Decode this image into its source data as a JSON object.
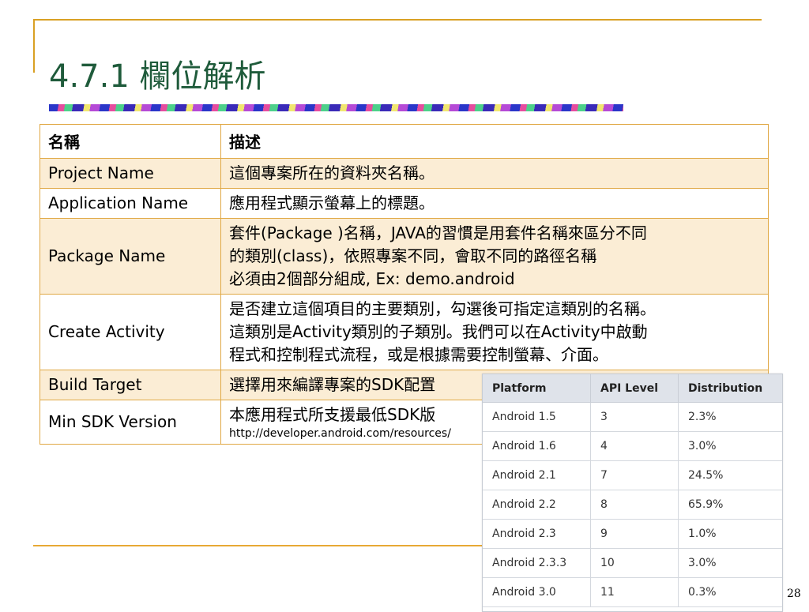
{
  "slide": {
    "title": "4.7.1 欄位解析",
    "page_number": "28"
  },
  "table": {
    "headers": [
      "名稱",
      "描述"
    ],
    "rows": [
      {
        "name": "Project Name",
        "desc": [
          "這個專案所在的資料夾名稱。"
        ]
      },
      {
        "name": "Application Name",
        "desc": [
          "應用程式顯示螢幕上的標題。"
        ]
      },
      {
        "name": "Package Name",
        "desc": [
          "套件(Package )名稱，JAVA的習慣是用套件名稱來區分不同",
          "的類別(class)，依照專案不同，會取不同的路徑名稱",
          "必須由2個部分組成, Ex: demo.android"
        ]
      },
      {
        "name": "Create Activity",
        "desc": [
          "是否建立這個項目的主要類別，勾選後可指定這類別的名稱。",
          "這類別是Activity類別的子類別。我們可以在Activity中啟動",
          "程式和控制程式流程，或是根據需要控制螢幕、介面。"
        ]
      },
      {
        "name": "Build Target",
        "desc": [
          "選擇用來編譯專案的SDK配置"
        ]
      },
      {
        "name": "Min SDK Version",
        "desc": [
          "本應用程式所支援最低SDK版"
        ],
        "url": "http://developer.android.com/resources/"
      }
    ]
  },
  "sdk_table": {
    "headers": [
      "Platform",
      "API Level",
      "Distribution"
    ],
    "rows": [
      [
        "Android 1.5",
        "3",
        "2.3%"
      ],
      [
        "Android 1.6",
        "4",
        "3.0%"
      ],
      [
        "Android 2.1",
        "7",
        "24.5%"
      ],
      [
        "Android 2.2",
        "8",
        "65.9%"
      ],
      [
        "Android 2.3",
        "9",
        "1.0%"
      ],
      [
        "Android 2.3.3",
        "10",
        "3.0%"
      ],
      [
        "Android 3.0",
        "11",
        "0.3%"
      ]
    ]
  },
  "colors": {
    "frame": "#d9a024",
    "title": "#1f5b3b",
    "table_border": "#e0a844",
    "row_tint": "#fbedd5"
  }
}
